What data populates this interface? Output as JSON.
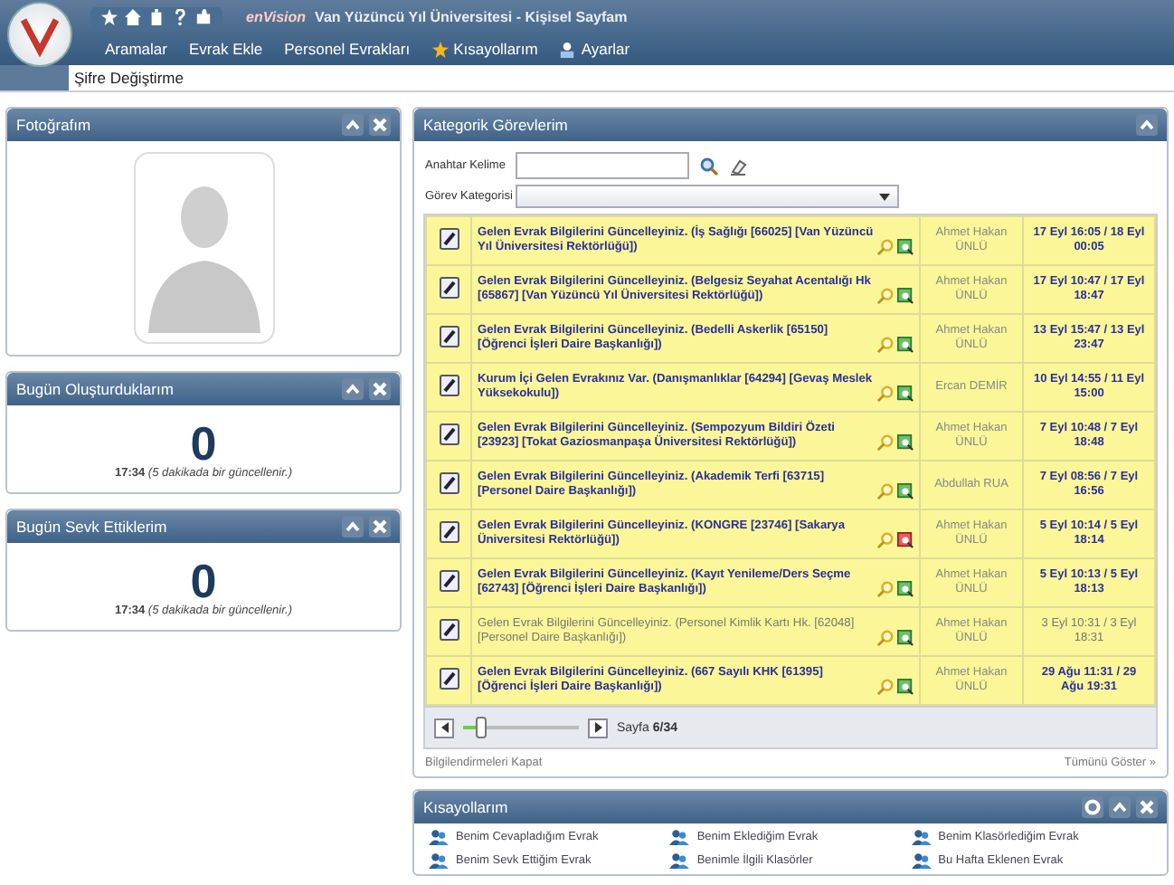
{
  "header": {
    "brand": "enVision",
    "title": "Van Yüzüncü Yıl Üniversitesi - Kişisel Sayfam",
    "menu": [
      {
        "label": "Aramalar"
      },
      {
        "label": "Evrak Ekle"
      },
      {
        "label": "Personel Evrakları"
      },
      {
        "label": "Kısayollarım"
      },
      {
        "label": "Ayarlar"
      }
    ],
    "submenu": [
      "Şifre Değiştirme"
    ]
  },
  "photo_panel": {
    "title": "Fotoğrafım"
  },
  "counters": [
    {
      "title": "Bugün Oluşturduklarım",
      "count": "0",
      "time": "17:34",
      "note": "(5 dakikada bir güncellenir.)"
    },
    {
      "title": "Bugün Sevk Ettiklerim",
      "count": "0",
      "time": "17:34",
      "note": "(5 dakikada bir güncellenir.)"
    }
  ],
  "tasks": {
    "title": "Kategorik Görevlerim",
    "keyword_label": "Anahtar Kelime",
    "category_label": "Görev Kategorisi",
    "rows": [
      {
        "subject": "Gelen Evrak Bilgilerini Güncelleyiniz. (İş Sağlığı [66025] [Van Yüzüncü Yıl Üniversitesi Rektörlüğü])",
        "user": "Ahmet Hakan ÜNLÜ",
        "date": "17 Eyl 16:05 / 18 Eyl 00:05",
        "read": false,
        "alert": false
      },
      {
        "subject": "Gelen Evrak Bilgilerini Güncelleyiniz. (Belgesiz Seyahat Acentalığı Hk [65867] [Van Yüzüncü Yıl Üniversitesi Rektörlüğü])",
        "user": "Ahmet Hakan ÜNLÜ",
        "date": "17 Eyl 10:47 / 17 Eyl 18:47",
        "read": false,
        "alert": false
      },
      {
        "subject": "Gelen Evrak Bilgilerini Güncelleyiniz. (Bedelli Askerlik [65150] [Öğrenci İşleri Daire Başkanlığı])",
        "user": "Ahmet Hakan ÜNLÜ",
        "date": "13 Eyl 15:47 / 13 Eyl 23:47",
        "read": false,
        "alert": false
      },
      {
        "subject": "Kurum İçi Gelen Evrakınız Var. (Danışmanlıklar [64294] [Gevaş Meslek Yüksekokulu])",
        "user": "Ercan DEMİR",
        "date": "10 Eyl 14:55 / 11 Eyl 15:00",
        "read": false,
        "alert": false
      },
      {
        "subject": "Gelen Evrak Bilgilerini Güncelleyiniz. (Sempozyum Bildiri Özeti [23923] [Tokat Gaziosmanpaşa Üniversitesi Rektörlüğü])",
        "user": "Ahmet Hakan ÜNLÜ",
        "date": "7 Eyl 10:48 / 7 Eyl 18:48",
        "read": false,
        "alert": false
      },
      {
        "subject": "Gelen Evrak Bilgilerini Güncelleyiniz. (Akademik Terfi [63715] [Personel Daire Başkanlığı])",
        "user": "Abdullah RUA",
        "date": "7 Eyl 08:56 / 7 Eyl 16:56",
        "read": false,
        "alert": false
      },
      {
        "subject": "Gelen Evrak Bilgilerini Güncelleyiniz. (KONGRE [23746] [Sakarya Üniversitesi Rektörlüğü])",
        "user": "Ahmet Hakan ÜNLÜ",
        "date": "5 Eyl 10:14 / 5 Eyl 18:14",
        "read": false,
        "alert": true
      },
      {
        "subject": "Gelen Evrak Bilgilerini Güncelleyiniz. (Kayıt Yenileme/Ders Seçme [62743] [Öğrenci İşleri Daire Başkanlığı])",
        "user": "Ahmet Hakan ÜNLÜ",
        "date": "5 Eyl 10:13 / 5 Eyl 18:13",
        "read": false,
        "alert": false
      },
      {
        "subject": "Gelen Evrak Bilgilerini Güncelleyiniz. (Personel Kimlik Kartı Hk. [62048] [Personel Daire Başkanlığı])",
        "user": "Ahmet Hakan ÜNLÜ",
        "date": "3 Eyl 10:31 / 3 Eyl 18:31",
        "read": true,
        "alert": false
      },
      {
        "subject": "Gelen Evrak Bilgilerini Güncelleyiniz. (667 Sayılı KHK [61395] [Öğrenci İşleri Daire Başkanlığı])",
        "user": "Ahmet Hakan ÜNLÜ",
        "date": "29 Ağu 11:31 / 29 Ağu 19:31",
        "read": false,
        "alert": false
      }
    ],
    "pager": {
      "level": 0.15,
      "label": "Sayfa",
      "page": "6/34"
    },
    "close_link": "Bilgilendirmeleri Kapat",
    "show_all_link": "Tümünü Göster »"
  },
  "shortcuts": {
    "title": "Kısayollarım",
    "items": [
      "Benim Cevapladığım Evrak",
      "Benim Eklediğim Evrak",
      "Benim Klasörlediğim Evrak",
      "Benim Sevk Ettiğim Evrak",
      "Benimle İlgili Klasörler",
      "Bu Hafta Eklenen Evrak"
    ]
  }
}
